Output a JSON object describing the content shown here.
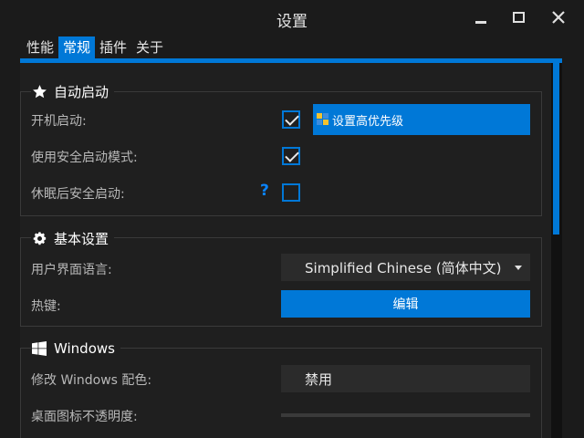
{
  "window": {
    "title": "设置"
  },
  "tabs": [
    {
      "label": "性能",
      "active": false
    },
    {
      "label": "常规",
      "active": true
    },
    {
      "label": "插件",
      "active": false
    },
    {
      "label": "关于",
      "active": false
    }
  ],
  "groups": {
    "autostart": {
      "title": "自动启动",
      "icon": "star-icon",
      "rows": {
        "boot_label": "开机启动:",
        "boot_checked": true,
        "priority_button": "设置高优先级",
        "safe_mode_label": "使用安全启动模式:",
        "safe_mode_checked": true,
        "after_sleep_label": "休眠后安全启动:",
        "after_sleep_help": "?",
        "after_sleep_checked": false
      }
    },
    "basic": {
      "title": "基本设置",
      "icon": "gear-icon",
      "language_label": "用户界面语言:",
      "language_value": "Simplified Chinese (简体中文)",
      "hotkey_label": "热键:",
      "hotkey_button": "编辑"
    },
    "windows": {
      "title": "Windows",
      "icon": "windows-logo-icon",
      "color_label": "修改 Windows 配色:",
      "color_value": "禁用",
      "opacity_label": "桌面图标不透明度:"
    }
  },
  "colors": {
    "accent": "#0078d7",
    "background": "#1b1b1b",
    "panel": "#1f1f1f",
    "border": "#3a3a3a"
  }
}
